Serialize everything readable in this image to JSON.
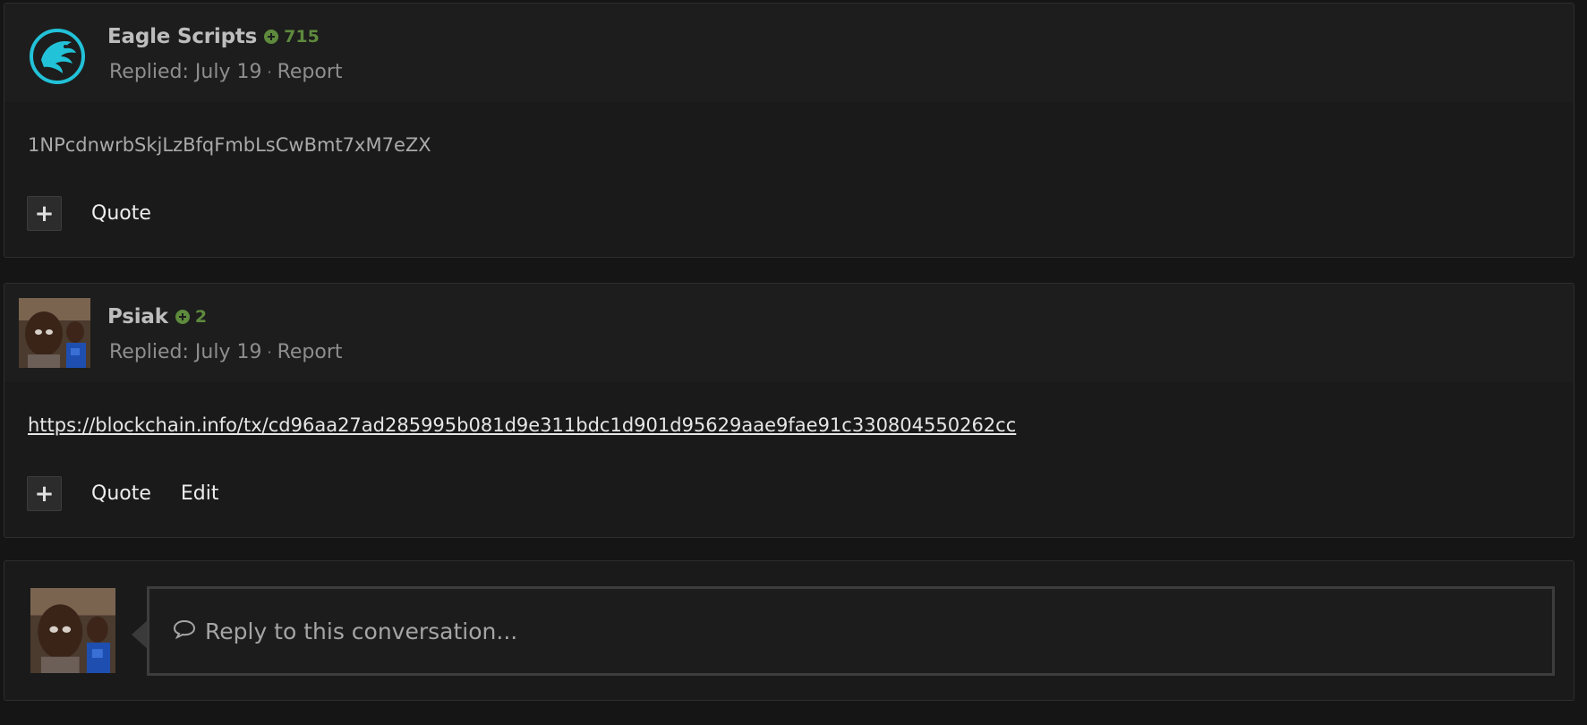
{
  "posts": [
    {
      "author": "Eagle Scripts",
      "reputation": "715",
      "replied": "Replied: July 19",
      "report": "Report",
      "body": "1NPcdnwrbSkjLzBfqFmbLsCwBmt7xM7eZX",
      "actions": {
        "plus": "+",
        "quote": "Quote"
      },
      "avatar": "eagle-logo"
    },
    {
      "author": "Psiak",
      "reputation": "2",
      "replied": "Replied: July 19",
      "report": "Report",
      "body": "https://blockchain.info/tx/cd96aa27ad285995b081d9e311bdc1d901d95629aae9fae91c330804550262cc",
      "actions": {
        "plus": "+",
        "quote": "Quote",
        "edit": "Edit"
      },
      "avatar": "user-photo"
    }
  ],
  "reply": {
    "placeholder": "Reply to this conversation...",
    "icon": "speech-bubble-icon",
    "avatar": "user-photo"
  },
  "colors": {
    "background": "#151515",
    "panel": "#1a1a1a",
    "reputation": "#5e8a3d",
    "eagle": "#22c2d8"
  }
}
